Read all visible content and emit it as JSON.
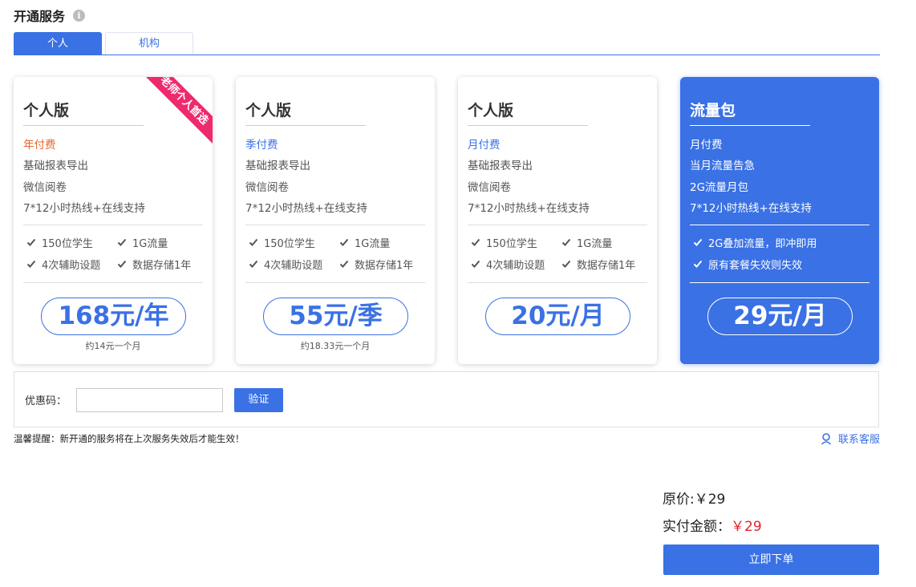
{
  "header": {
    "title": "开通服务",
    "info_icon": "i"
  },
  "tabs": [
    {
      "label": "个人",
      "active": true
    },
    {
      "label": "机构",
      "active": false
    }
  ],
  "colors": {
    "accent": "#3a71e4",
    "ribbon": "#ee2a6e",
    "period_orange": "#e8652b",
    "price_red": "#e0252a"
  },
  "plans": [
    {
      "title": "个人版",
      "period": "年付费",
      "features": [
        "基础报表导出",
        "微信阅卷",
        "7*12小时热线+在线支持"
      ],
      "checks": [
        "150位学生",
        "1G流量",
        "4次辅助设题",
        "数据存储1年"
      ],
      "price": "168元/年",
      "price_sub": "约14元一个月",
      "ribbon": "老师个人首选"
    },
    {
      "title": "个人版",
      "period": "季付费",
      "features": [
        "基础报表导出",
        "微信阅卷",
        "7*12小时热线+在线支持"
      ],
      "checks": [
        "150位学生",
        "1G流量",
        "4次辅助设题",
        "数据存储1年"
      ],
      "price": "55元/季",
      "price_sub": "约18.33元一个月"
    },
    {
      "title": "个人版",
      "period": "月付费",
      "features": [
        "基础报表导出",
        "微信阅卷",
        "7*12小时热线+在线支持"
      ],
      "checks": [
        "150位学生",
        "1G流量",
        "4次辅助设题",
        "数据存储1年"
      ],
      "price": "20元/月"
    },
    {
      "title": "流量包",
      "period": "月付费",
      "features": [
        "当月流量告急",
        "2G流量月包",
        "7*12小时热线+在线支持"
      ],
      "checks": [
        "2G叠加流量，即冲即用",
        "原有套餐失效则失效"
      ],
      "price": "29元/月",
      "selected": true
    }
  ],
  "coupon": {
    "label": "优惠码：",
    "value": "",
    "placeholder": "",
    "verify_label": "验证"
  },
  "notice": "温馨提醒：新开通的服务将在上次服务失效后才能生效！",
  "support": {
    "label": "联系客服",
    "icon": "user-icon"
  },
  "summary": {
    "original_label": "原价:",
    "original_value": "￥29",
    "paid_label": "实付金额：",
    "paid_value": "￥29"
  },
  "order_button": "立即下单"
}
